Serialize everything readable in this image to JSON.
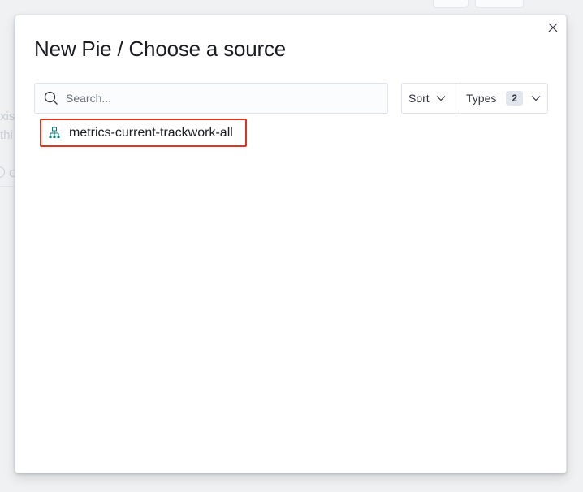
{
  "background": {
    "frag1": "xis",
    "frag2": "thi",
    "frag3": "C"
  },
  "modal": {
    "title": "New Pie / Choose a source",
    "close_icon": "close-icon"
  },
  "search": {
    "placeholder": "Search...",
    "value": ""
  },
  "filters": {
    "sort_label": "Sort",
    "types_label": "Types",
    "types_count": "2"
  },
  "results": [
    {
      "label": "metrics-current-trackwork-all",
      "icon": "index-pattern-icon"
    }
  ],
  "colors": {
    "highlight": "#e2341d",
    "index_icon": "#017d73"
  }
}
